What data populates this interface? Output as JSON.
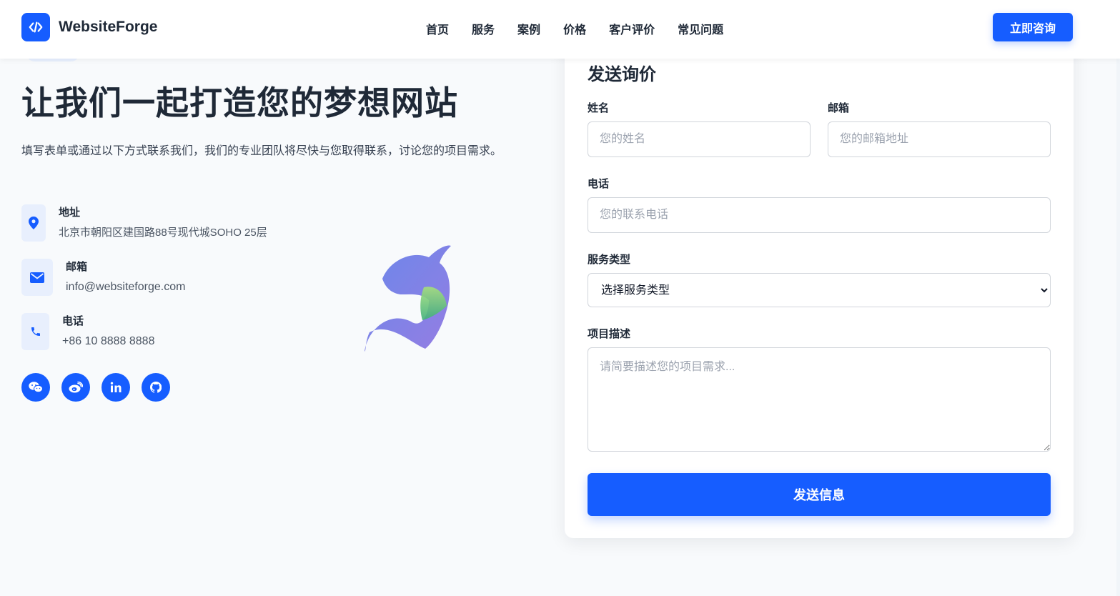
{
  "brand": {
    "name": "WebsiteForge",
    "logo_icon": "code-icon",
    "accent_color": "#165dff"
  },
  "nav": {
    "items": [
      {
        "label": "首页"
      },
      {
        "label": "服务"
      },
      {
        "label": "案例"
      },
      {
        "label": "价格"
      },
      {
        "label": "客户评价"
      },
      {
        "label": "常见问题"
      }
    ],
    "cta_label": "立即咨询"
  },
  "hero": {
    "title": "让我们一起打造您的梦想网站",
    "description": "填写表单或通过以下方式联系我们，我们的专业团队将尽快与您取得联系，讨论您的项目需求。"
  },
  "contacts": [
    {
      "icon": "map-pin-icon",
      "label": "地址",
      "value": "北京市朝阳区建国路88号现代城SOHO 25层"
    },
    {
      "icon": "envelope-icon",
      "label": "邮箱",
      "value": "info@websiteforge.com"
    },
    {
      "icon": "phone-icon",
      "label": "电话",
      "value": "+86 10 8888 8888"
    }
  ],
  "socials": [
    {
      "icon": "wechat-icon"
    },
    {
      "icon": "weibo-icon"
    },
    {
      "icon": "linkedin-icon"
    },
    {
      "icon": "github-icon"
    }
  ],
  "form": {
    "title": "发送询价",
    "name": {
      "label": "姓名",
      "placeholder": "您的姓名",
      "value": ""
    },
    "email": {
      "label": "邮箱",
      "placeholder": "您的邮箱地址",
      "value": ""
    },
    "phone": {
      "label": "电话",
      "placeholder": "您的联系电话",
      "value": ""
    },
    "service": {
      "label": "服务类型",
      "selected": "选择服务类型"
    },
    "description": {
      "label": "项目描述",
      "placeholder": "请简要描述您的项目需求..."
    },
    "submit_label": "发送信息"
  }
}
